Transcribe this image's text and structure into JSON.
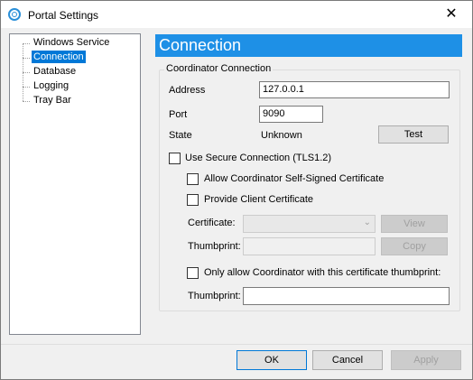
{
  "window": {
    "title": "Portal Settings",
    "close_glyph": "✕"
  },
  "tree": {
    "items": [
      {
        "label": "Windows Service"
      },
      {
        "label": "Connection"
      },
      {
        "label": "Database"
      },
      {
        "label": "Logging"
      },
      {
        "label": "Tray Bar"
      }
    ],
    "selected_index": 1
  },
  "section": {
    "title": "Connection"
  },
  "coordinator": {
    "group_label": "Coordinator Connection",
    "address_label": "Address",
    "address_value": "127.0.0.1",
    "port_label": "Port",
    "port_value": "9090",
    "state_label": "State",
    "state_value": "Unknown",
    "test_button": "Test",
    "use_secure_label": "Use Secure Connection (TLS1.2)",
    "allow_self_signed_label": "Allow Coordinator Self-Signed Certificate",
    "provide_client_cert_label": "Provide Client Certificate",
    "certificate_label": "Certificate:",
    "certificate_value": "",
    "view_button": "View",
    "thumbprint_label": "Thumbprint:",
    "thumbprint_value": "",
    "copy_button": "Copy",
    "only_allow_label": "Only allow Coordinator with this certificate thumbprint:",
    "thumbprint2_label": "Thumbprint:",
    "thumbprint2_value": ""
  },
  "footer": {
    "ok": "OK",
    "cancel": "Cancel",
    "apply": "Apply"
  },
  "colors": {
    "header_bg": "#1e90e6",
    "selection": "#0078d7"
  }
}
